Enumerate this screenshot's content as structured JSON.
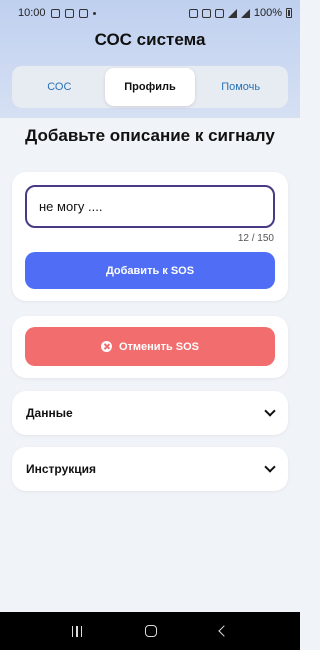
{
  "status_bar": {
    "time": "10:00",
    "battery": "100%",
    "icons": [
      "image-icon",
      "chat-icon",
      "check-icon",
      "dot-icon",
      "key-icon",
      "sim-icon",
      "volte-icon",
      "wifi-icon",
      "signal-icon",
      "battery-icon"
    ]
  },
  "app": {
    "title": "СОС система"
  },
  "tabs": [
    {
      "label": "СОС",
      "active": false
    },
    {
      "label": "Профиль",
      "active": true
    },
    {
      "label": "Помочь",
      "active": false
    }
  ],
  "main": {
    "heading": "Добавьте описание к сигналу",
    "input_value": "не могу ....",
    "counter": "12 / 150",
    "add_button": "Добавить к SOS",
    "cancel_button": "Отменить SOS"
  },
  "accordions": [
    {
      "label": "Данные"
    },
    {
      "label": "Инструкция"
    }
  ],
  "colors": {
    "primary": "#4f6ef5",
    "danger": "#f26e6e",
    "tab_link": "#2a72b6",
    "input_border": "#4a3a86"
  }
}
